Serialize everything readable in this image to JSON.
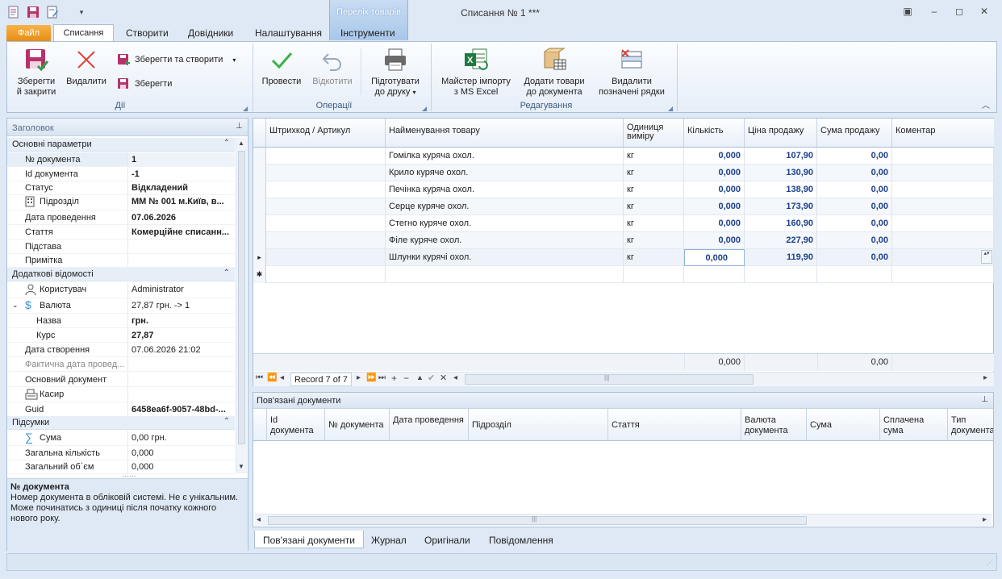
{
  "title_bar": {
    "context_tab": "Перелік товарів",
    "window_title": "Списання № 1 ***"
  },
  "ribbon_tabs": [
    "Файл",
    "Списання",
    "Створити",
    "Довідники",
    "Налаштування",
    "Інструменти"
  ],
  "ribbon": {
    "groups": {
      "actions": "Дії",
      "operations": "Операції",
      "editing": "Редагування"
    },
    "save_close": [
      "Зберегти",
      "й закрити"
    ],
    "delete": "Видалити",
    "save_create": "Зберегти та створити",
    "save": "Зберегти",
    "post": "Провести",
    "cancel": "Відкотити",
    "print": [
      "Підготувати",
      "до друку"
    ],
    "import": [
      "Майстер імпорту",
      "з MS Excel"
    ],
    "add_goods": [
      "Додати товари",
      "до документа"
    ],
    "delete_rows": [
      "Видалити",
      "позначені рядки"
    ]
  },
  "left_panel": {
    "header": "Заголовок",
    "categories": {
      "main": "Основні параметри",
      "extra": "Додаткові відомості",
      "totals": "Підсумки"
    },
    "main_rows": [
      {
        "name": "№ документа",
        "value": "1"
      },
      {
        "name": "Id документа",
        "value": "-1"
      },
      {
        "name": "Статус",
        "value": "Відкладений"
      },
      {
        "name": "Підрозділ",
        "value": "ММ № 001 м.Київ, в..."
      },
      {
        "name": "Дата проведення",
        "value": "07.06.2026"
      },
      {
        "name": "Стаття",
        "value": "Комерційне списанн..."
      },
      {
        "name": "Підстава",
        "value": ""
      },
      {
        "name": "Примітка",
        "value": ""
      }
    ],
    "extra_rows": [
      {
        "name": "Користувач",
        "value": "Administrator"
      },
      {
        "name": "Валюта",
        "value": "27,87 грн. -> 1"
      },
      {
        "name": "Назва",
        "value": "грн."
      },
      {
        "name": "Курс",
        "value": "27,87"
      },
      {
        "name": "Дата створення",
        "value": "07.06.2026 21:02"
      },
      {
        "name": "Фактична дата провед...",
        "value": ""
      },
      {
        "name": "Основний документ",
        "value": ""
      },
      {
        "name": "Касир",
        "value": ""
      },
      {
        "name": "Guid",
        "value": "6458ea6f-9057-48bd-..."
      }
    ],
    "totals_rows": [
      {
        "name": "Сума",
        "value": "0,00 грн."
      },
      {
        "name": "Загальна кількість",
        "value": "0,000"
      },
      {
        "name": "Загальний об`єм",
        "value": "0,000"
      }
    ],
    "description_title": "№ документа",
    "description_text": "Номер документа в обліковій системі. Не є унікальним. Може починатись з одиниці після початку кожного нового року."
  },
  "grid": {
    "columns": [
      "Штрихкод / Артикул",
      "Найменування товару",
      "Одиниця виміру",
      "Кількість",
      "Ціна продажу",
      "Сума продажу",
      "Коментар"
    ],
    "rows": [
      {
        "code": "",
        "name": "Гомілка куряча охол.",
        "unit": "кг",
        "qty": "0,000",
        "price": "107,90",
        "sum": "0,00",
        "comment": ""
      },
      {
        "code": "",
        "name": "Крило куряче охол.",
        "unit": "кг",
        "qty": "0,000",
        "price": "130,90",
        "sum": "0,00",
        "comment": ""
      },
      {
        "code": "",
        "name": "Печінка куряча охол.",
        "unit": "кг",
        "qty": "0,000",
        "price": "138,90",
        "sum": "0,00",
        "comment": ""
      },
      {
        "code": "",
        "name": "Серце куряче охол.",
        "unit": "кг",
        "qty": "0,000",
        "price": "173,90",
        "sum": "0,00",
        "comment": ""
      },
      {
        "code": "",
        "name": "Стегно куряче охол.",
        "unit": "кг",
        "qty": "0,000",
        "price": "160,90",
        "sum": "0,00",
        "comment": ""
      },
      {
        "code": "",
        "name": "Філе куряче охол.",
        "unit": "кг",
        "qty": "0,000",
        "price": "227,90",
        "sum": "0,00",
        "comment": ""
      },
      {
        "code": "",
        "name": "Шлунки курячі охол.",
        "unit": "кг",
        "qty": "0,000",
        "price": "119,90",
        "sum": "0,00",
        "comment": ""
      }
    ],
    "footer_qty": "0,000",
    "footer_sum": "0,00",
    "record_text": "Record 7 of 7"
  },
  "related": {
    "title": "Пов'язані документи",
    "columns": [
      "Id документа",
      "№ документа",
      "Дата проведення",
      "Підрозділ",
      "Стаття",
      "Валюта документа",
      "Сума",
      "Сплачена сума",
      "Тип документа"
    ]
  },
  "bottom_tabs": [
    "Пов'язані документи",
    "Журнал",
    "Оригінали",
    "Повідомлення"
  ]
}
